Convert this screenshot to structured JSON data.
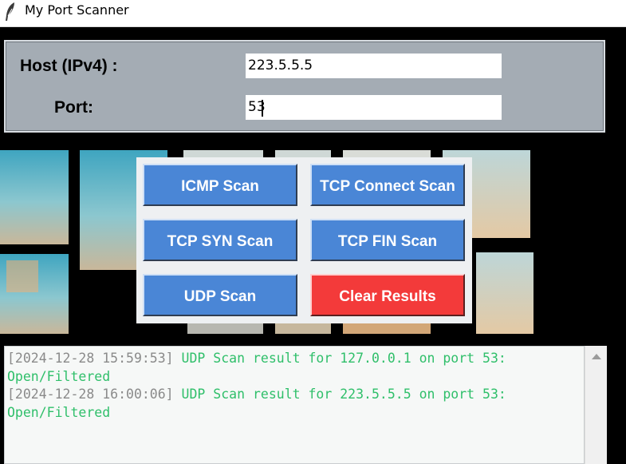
{
  "window": {
    "title": "My Port Scanner",
    "icon": "feather-icon"
  },
  "inputs": {
    "host_label": "Host (IPv4) :",
    "host_value": "223.5.5.5",
    "port_label": "Port:",
    "port_value": "53"
  },
  "buttons": {
    "icmp": "ICMP Scan",
    "tcp_connect": "TCP Connect Scan",
    "tcp_syn": "TCP SYN Scan",
    "tcp_fin": "TCP FIN Scan",
    "udp": "UDP Scan",
    "clear": "Clear Results"
  },
  "results": [
    {
      "timestamp": "[2024-12-28 15:59:53]",
      "message": " UDP Scan result for 127.0.0.1 on port 53: Open/Filtered"
    },
    {
      "timestamp": "[2024-12-28 16:00:06]",
      "message": " UDP Scan result for 223.5.5.5 on port 53: Open/Filtered"
    }
  ],
  "colors": {
    "button_blue": "#4a86d6",
    "button_red": "#f33a3a",
    "result_text": "#2fbf6a",
    "timestamp_text": "#8a8a8a",
    "panel_gray": "#a4acb4"
  }
}
